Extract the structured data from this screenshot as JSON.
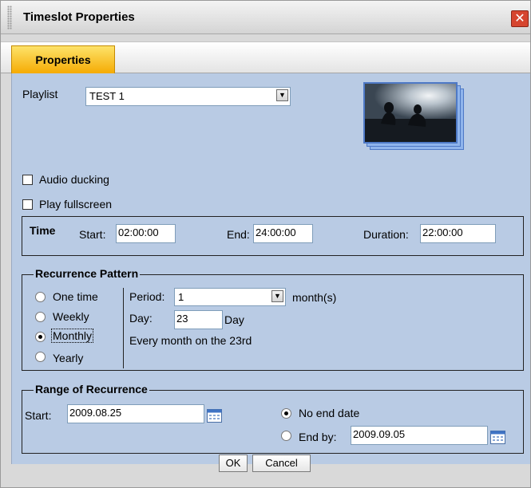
{
  "window": {
    "title": "Timeslot Properties"
  },
  "tabs": [
    {
      "label": "Properties"
    }
  ],
  "playlist": {
    "label": "Playlist",
    "value": "TEST 1"
  },
  "options": {
    "audio_ducking": {
      "label": "Audio ducking",
      "checked": false
    },
    "play_fullscreen": {
      "label": "Play fullscreen",
      "checked": false
    }
  },
  "time": {
    "label": "Time",
    "start_label": "Start:",
    "start_value": "02:00:00",
    "end_label": "End:",
    "end_value": "24:00:00",
    "duration_label": "Duration:",
    "duration_value": "22:00:00"
  },
  "recurrence": {
    "title": "Recurrence Pattern",
    "options": [
      "One time",
      "Weekly",
      "Monthly",
      "Yearly"
    ],
    "selected": "Monthly",
    "period_label": "Period:",
    "period_value": "1",
    "period_unit": "month(s)",
    "day_label": "Day:",
    "day_value": "23",
    "day_unit": "Day",
    "summary": "Every month on the 23rd"
  },
  "range": {
    "title": "Range of Recurrence",
    "start_label": "Start:",
    "start_value": "2009.08.25",
    "no_end_label": "No end date",
    "end_by_label": "End by:",
    "end_by_value": "2009.09.05",
    "selected": "No end date"
  },
  "buttons": {
    "ok": "OK",
    "cancel": "Cancel"
  },
  "colors": {
    "panel": "#b9cbe4",
    "tab_active": "#f5b800",
    "close": "#d6452f"
  }
}
